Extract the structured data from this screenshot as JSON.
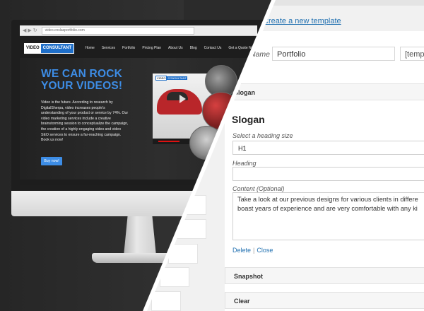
{
  "browser": {
    "url": "video.cnslasportfolio.com"
  },
  "website": {
    "logo_part1": "VIDEO",
    "logo_part2": "CONSULTANT",
    "nav": [
      "Home",
      "Services",
      "Portfolio",
      "Pricing Plan",
      "About Us",
      "Blog",
      "Contact Us",
      "Get a Quote Now"
    ],
    "headline_line1": "WE CAN ROCK",
    "headline_line2": "YOUR VIDEOS!",
    "paragraph": "Video is the future. According to research by DigitalSherpa, video increases people's understanding of your product or service by 74%. Our video marketing services include a creative brainstorming session to conceptualize the campaign, the creation of a highly-engaging video and video SEO services to ensure a far-reaching campaign. Book us now!",
    "cta_label": "Buy now!",
    "accent": "#3d8de6"
  },
  "admin": {
    "create_link": "Create a new template",
    "name_label": "Name",
    "name_value": "Portfolio",
    "template_value": "[templ",
    "panel_slogan_label": "Slogan",
    "slogan_title": "Slogan",
    "heading_size_label": "Select a heading size",
    "heading_size_value": "H1",
    "heading_label": "Heading",
    "heading_value": "",
    "content_label": "Content (Optional)",
    "content_value": "Take a look at our previous designs for various clients in differe\nboast years of experience and are very comfortable with any ki",
    "delete_label": "Delete",
    "separator": "|",
    "close_label": "Close",
    "panel_snapshot_label": "Snapshot",
    "panel_clear_label": "Clear",
    "link_color": "#2271b1"
  }
}
